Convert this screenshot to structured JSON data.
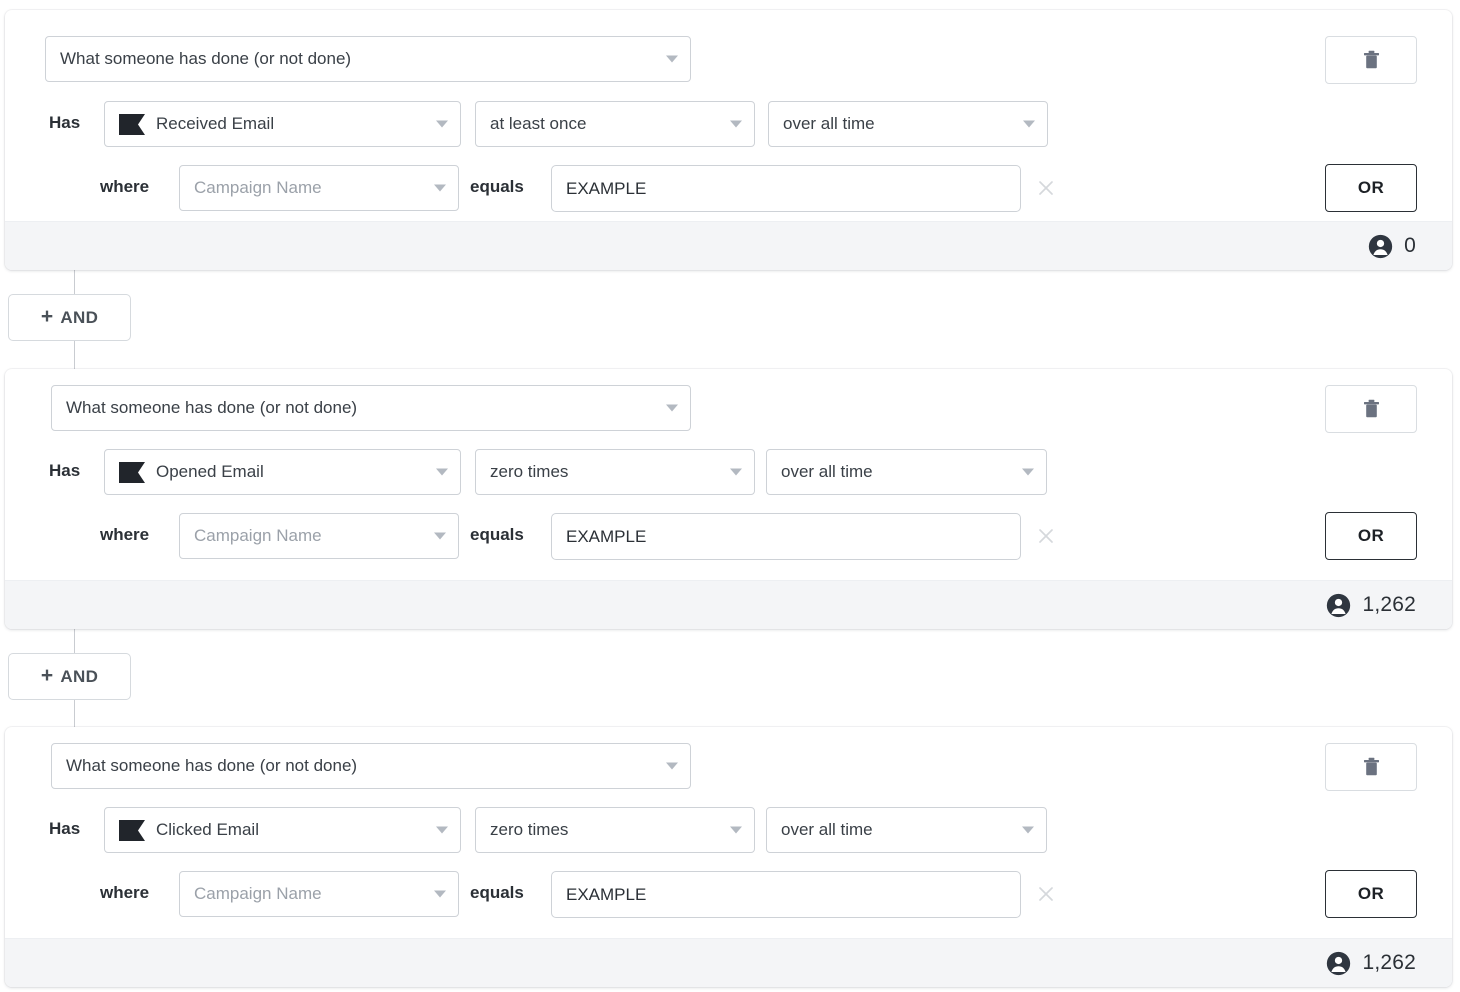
{
  "colors": {
    "accent_border": "#2b3036",
    "footer_bg": "#f4f5f7",
    "field_border": "#ced2d7",
    "caret": "#b3b9c1",
    "muted_text": "#9ba1a9"
  },
  "builder": {
    "groups": [
      {
        "type_select": {
          "value": "What someone has done (or not done)"
        },
        "has_label": "Has",
        "event_select": {
          "value": "Received Email",
          "icon": "flag-icon"
        },
        "frequency_select": {
          "value": "at least once"
        },
        "timeframe_select": {
          "value": "over all time"
        },
        "where_label": "where",
        "attribute_select": {
          "value": "Campaign Name"
        },
        "operator_label": "equals",
        "value_input": {
          "value": "EXAMPLE",
          "placeholder": ""
        },
        "clear_icon": "close-icon",
        "delete_icon": "trash-icon",
        "or_label": "OR",
        "count": {
          "icon": "person-icon",
          "value": "0"
        }
      },
      {
        "type_select": {
          "value": "What someone has done (or not done)"
        },
        "has_label": "Has",
        "event_select": {
          "value": "Opened Email",
          "icon": "flag-icon"
        },
        "frequency_select": {
          "value": "zero times"
        },
        "timeframe_select": {
          "value": "over all time"
        },
        "where_label": "where",
        "attribute_select": {
          "value": "Campaign Name"
        },
        "operator_label": "equals",
        "value_input": {
          "value": "EXAMPLE",
          "placeholder": ""
        },
        "clear_icon": "close-icon",
        "delete_icon": "trash-icon",
        "or_label": "OR",
        "count": {
          "icon": "person-icon",
          "value": "1,262"
        }
      },
      {
        "type_select": {
          "value": "What someone has done (or not done)"
        },
        "has_label": "Has",
        "event_select": {
          "value": "Clicked Email",
          "icon": "flag-icon"
        },
        "frequency_select": {
          "value": "zero times"
        },
        "timeframe_select": {
          "value": "over all time"
        },
        "where_label": "where",
        "attribute_select": {
          "value": "Campaign Name"
        },
        "operator_label": "equals",
        "value_input": {
          "value": "EXAMPLE",
          "placeholder": ""
        },
        "clear_icon": "close-icon",
        "delete_icon": "trash-icon",
        "or_label": "OR",
        "count": {
          "icon": "person-icon",
          "value": "1,262"
        }
      }
    ],
    "and_buttons": [
      {
        "plus": "+",
        "label": "AND"
      },
      {
        "plus": "+",
        "label": "AND"
      }
    ]
  }
}
